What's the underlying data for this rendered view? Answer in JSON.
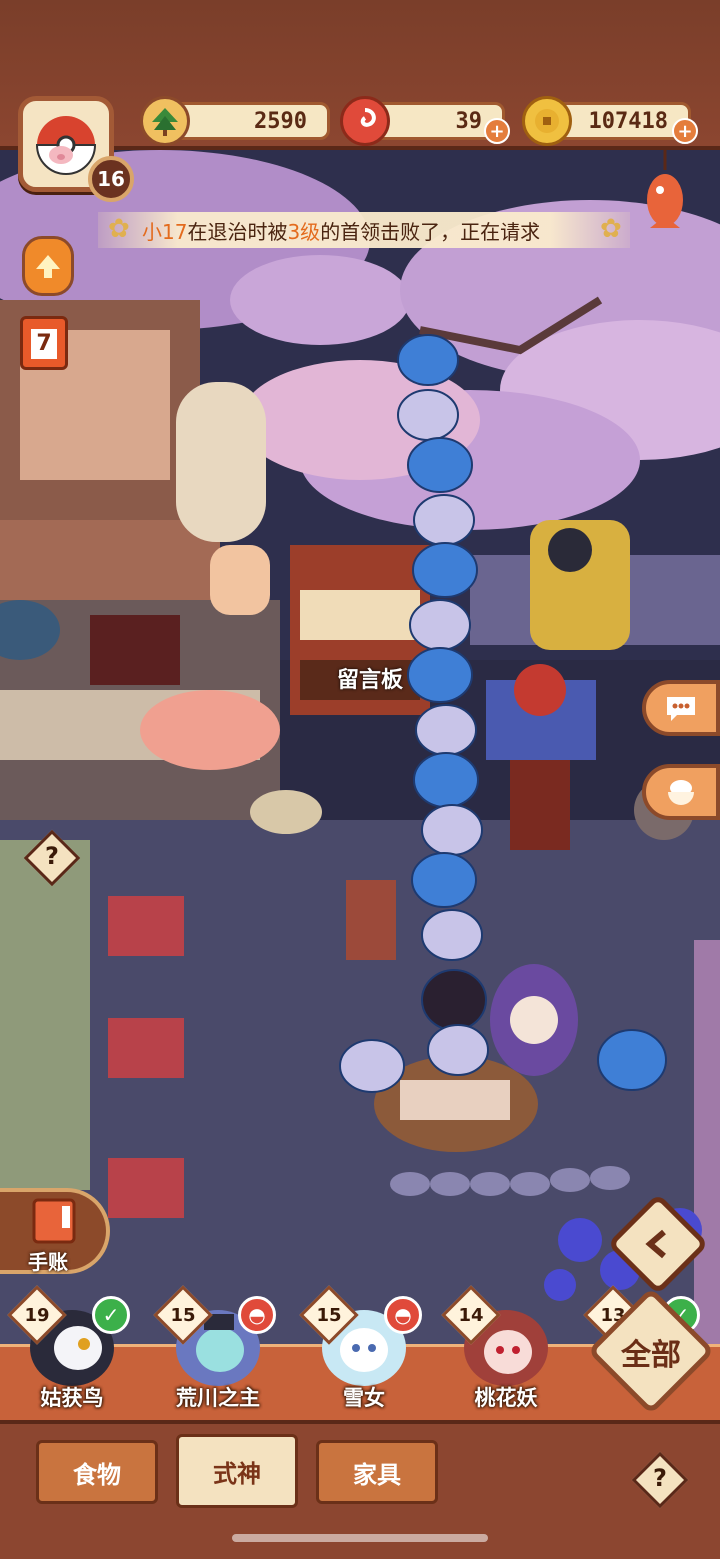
{
  "player": {
    "level": "16",
    "avatar_icon": "pig-in-capsule-icon"
  },
  "resources": [
    {
      "name": "pine-currency",
      "value": "2590",
      "icon": "pine-icon"
    },
    {
      "name": "red-ticket",
      "value": "39",
      "icon": "red-swirl-icon"
    },
    {
      "name": "coins",
      "value": "107418",
      "icon": "coin-icon"
    }
  ],
  "notice": {
    "prefix": "小17",
    "part1": "在退治时被",
    "level": "3级",
    "part2": "的首领击败了，正在请求"
  },
  "calendar_day": "7",
  "board_sign": "留言板",
  "side_buttons": {
    "chat_icon": "chat-bubble-icon",
    "cooking_icon": "rice-bowl-icon"
  },
  "journal": {
    "label": "手账"
  },
  "shikigami": [
    {
      "level": "19",
      "name": "姑获鸟",
      "status": "check"
    },
    {
      "level": "15",
      "name": "荒川之主",
      "status": "dish"
    },
    {
      "level": "15",
      "name": "雪女",
      "status": "dish"
    },
    {
      "level": "14",
      "name": "桃花妖",
      "status": "none"
    },
    {
      "level": "13",
      "name": "",
      "status": "check"
    }
  ],
  "filter": {
    "all_label": "全部"
  },
  "tabs": [
    {
      "label": "食物",
      "active": false
    },
    {
      "label": "式神",
      "active": true
    },
    {
      "label": "家具",
      "active": false
    }
  ],
  "help_symbol": "?",
  "colors": {
    "accent": "#e36b1e",
    "frame": "#8c4630",
    "panel": "#f4e2c0"
  }
}
